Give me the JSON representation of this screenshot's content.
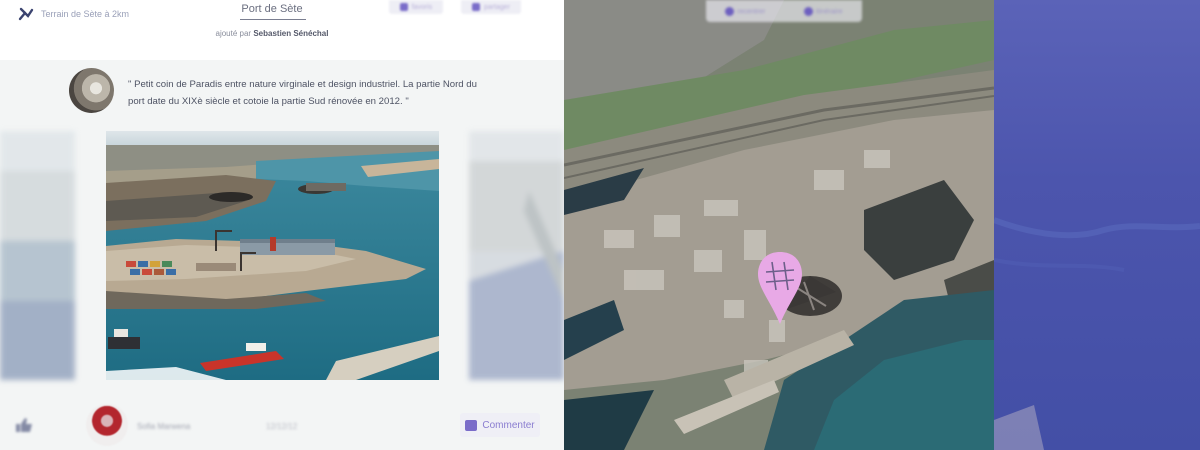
{
  "header": {
    "distance_label": "Terrain de Sète à 2km",
    "place_title": "Port de Sète",
    "added_by_prefix": "ajouté par",
    "added_by_author": "Sebastien Sénéchal",
    "button_1_label": "favoris",
    "button_2_label": "partager"
  },
  "post": {
    "quote": "\" Petit coin de Paradis entre nature virginale et design industriel. La partie Nord du port date du XIXè siècle et cotoie la partie Sud rénovée en 2012. \""
  },
  "footer": {
    "commenter_name": "Sofia Marwena",
    "comment_date": "12/12/12",
    "comment_button": "Commenter"
  },
  "map_toolbar": {
    "item_1": "recentrer",
    "item_2": "itinéraire"
  },
  "colors": {
    "accent": "#7a6cc9",
    "marker": "#e8a9e6",
    "marker_dark": "#3b3836",
    "sea_panel": "#4c55ad"
  },
  "icons": {
    "distance": "route-icon",
    "map_marker": "location-pin-icon",
    "comment": "speech-bubble-icon",
    "like": "thumbs-up-icon"
  }
}
